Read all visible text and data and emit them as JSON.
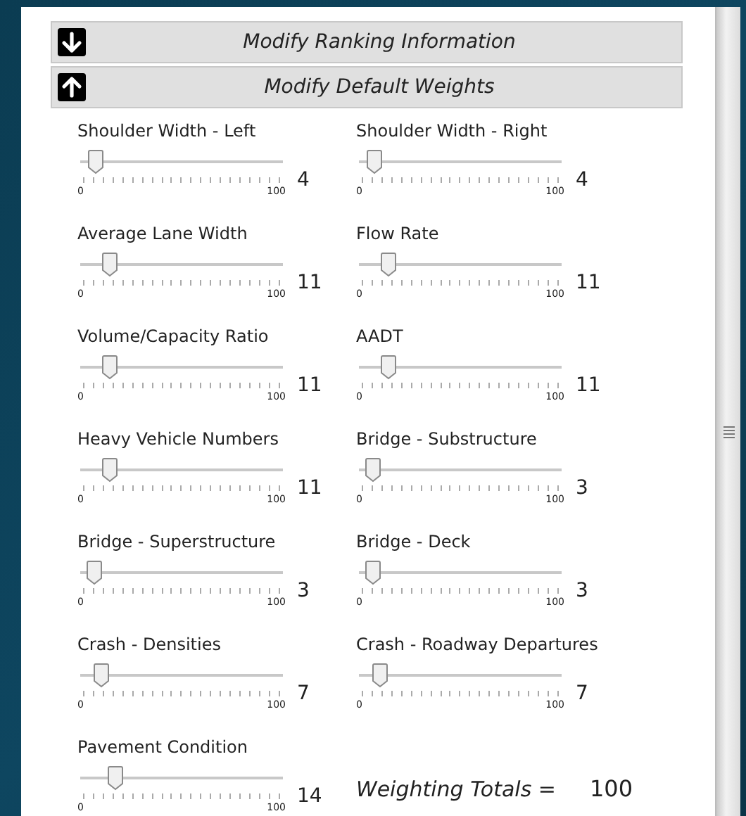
{
  "sections": [
    {
      "title": "Modify Ranking Information",
      "expanded": false
    },
    {
      "title": "Modify Default Weights",
      "expanded": true
    }
  ],
  "sliders": [
    {
      "label": "Shoulder Width - Left",
      "level": 0.04,
      "value": "4",
      "min": "0",
      "max": "100"
    },
    {
      "label": "Shoulder Width - Right",
      "level": 0.04,
      "value": "4",
      "min": "0",
      "max": "100"
    },
    {
      "label": "Average Lane Width",
      "level": 0.11,
      "value": "11",
      "min": "0",
      "max": "100"
    },
    {
      "label": "Flow Rate",
      "level": 0.11,
      "value": "11",
      "min": "0",
      "max": "100"
    },
    {
      "label": "Volume/Capacity Ratio",
      "level": 0.11,
      "value": "11",
      "min": "0",
      "max": "100"
    },
    {
      "label": "AADT",
      "level": 0.11,
      "value": "11",
      "min": "0",
      "max": "100"
    },
    {
      "label": "Heavy Vehicle Numbers",
      "level": 0.11,
      "value": "11",
      "min": "0",
      "max": "100"
    },
    {
      "label": "Bridge - Substructure",
      "level": 0.03,
      "value": "3",
      "min": "0",
      "max": "100"
    },
    {
      "label": "Bridge - Superstructure",
      "level": 0.03,
      "value": "3",
      "min": "0",
      "max": "100"
    },
    {
      "label": "Bridge - Deck",
      "level": 0.03,
      "value": "3",
      "min": "0",
      "max": "100"
    },
    {
      "label": "Crash - Densities",
      "level": 0.07,
      "value": "7",
      "min": "0",
      "max": "100"
    },
    {
      "label": "Crash - Roadway Departures",
      "level": 0.07,
      "value": "7",
      "min": "0",
      "max": "100"
    },
    {
      "label": "Pavement Condition",
      "level": 0.14,
      "value": "14",
      "min": "0",
      "max": "100"
    }
  ],
  "totals": {
    "label": "Weighting Totals =",
    "value": "100"
  }
}
